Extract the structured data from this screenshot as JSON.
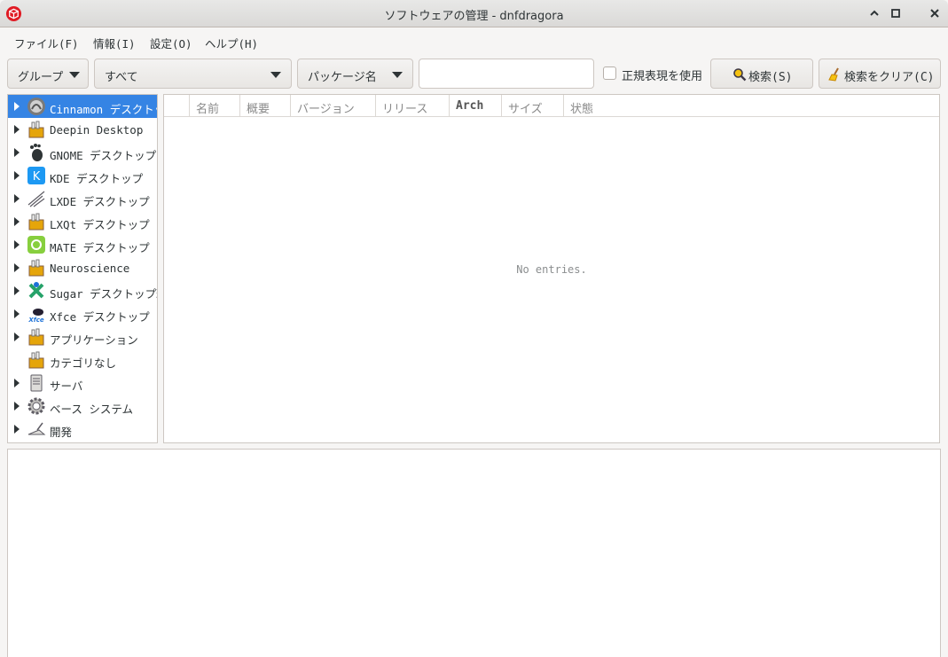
{
  "window": {
    "title": "ソフトウェアの管理 - dnfdragora",
    "app_icon": "dnfdragora-icon",
    "controls": [
      "minimize",
      "maximize",
      "close"
    ]
  },
  "menubar": {
    "file": "ファイル(F)",
    "info": "情報(I)",
    "settings": "設定(O)",
    "help": "ヘルプ(H)"
  },
  "toolbar": {
    "view_mode": "グループ",
    "filter": "すべて",
    "search_field": "パッケージ名",
    "search_text": "",
    "regex_label": "正規表現を使用",
    "regex_checked": false,
    "search_button": "検索(S)",
    "clear_button": "検索をクリア(C)"
  },
  "groups": [
    {
      "label": "Cinnamon デスクトップ",
      "icon": "cinnamon-icon",
      "expandable": true,
      "selected": true
    },
    {
      "label": "Deepin Desktop",
      "icon": "package-group-icon",
      "expandable": true
    },
    {
      "label": "GNOME デスクトップ",
      "icon": "gnome-foot-icon",
      "expandable": true
    },
    {
      "label": "KDE デスクトップ",
      "icon": "kde-icon",
      "expandable": true
    },
    {
      "label": "LXDE デスクトップ",
      "icon": "lxde-icon",
      "expandable": true
    },
    {
      "label": "LXQt デスクトップ",
      "icon": "package-group-icon",
      "expandable": true
    },
    {
      "label": "MATE デスクトップ",
      "icon": "mate-icon",
      "expandable": true
    },
    {
      "label": "Neuroscience",
      "icon": "package-group-icon",
      "expandable": true
    },
    {
      "label": "Sugar デスクトップ環境",
      "icon": "sugar-icon",
      "expandable": true
    },
    {
      "label": "Xfce デスクトップ",
      "icon": "xfce-icon",
      "expandable": true
    },
    {
      "label": "アプリケーション",
      "icon": "package-group-icon",
      "expandable": true
    },
    {
      "label": "カテゴリなし",
      "icon": "package-group-icon",
      "expandable": false
    },
    {
      "label": "サーバ",
      "icon": "server-icon",
      "expandable": true
    },
    {
      "label": "ベース システム",
      "icon": "gear-icon",
      "expandable": true
    },
    {
      "label": "開発",
      "icon": "development-icon",
      "expandable": true
    }
  ],
  "package_list": {
    "columns": [
      "",
      "名前",
      "概要",
      "バージョン",
      "リリース",
      "Arch",
      "サイズ",
      "状態"
    ],
    "empty_text": "No entries."
  },
  "colors": {
    "selection": "#3584e4",
    "window_bg": "#f6f5f4",
    "border": "#cdc7c2"
  }
}
